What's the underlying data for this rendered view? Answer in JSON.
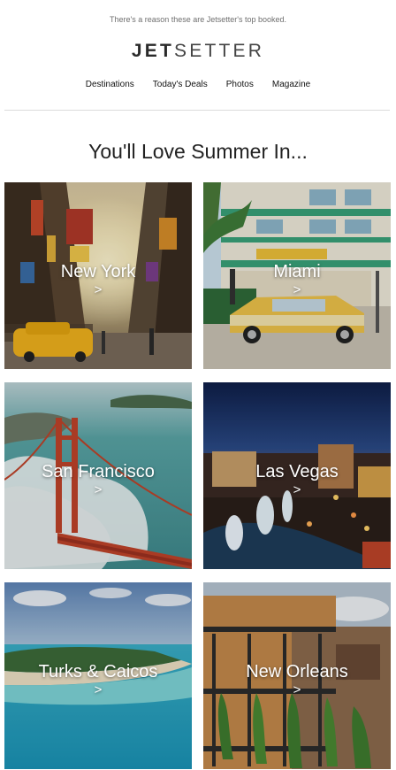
{
  "preheader": "There's a reason these are Jetsetter's top booked.",
  "logo": {
    "bold": "JET",
    "light": "SETTER"
  },
  "nav": [
    "Destinations",
    "Today's Deals",
    "Photos",
    "Magazine"
  ],
  "headline": "You'll Love Summer In...",
  "destinations": [
    {
      "name": "New York",
      "arrow": ">"
    },
    {
      "name": "Miami",
      "arrow": ">"
    },
    {
      "name": "San Francisco",
      "arrow": ">"
    },
    {
      "name": "Las Vegas",
      "arrow": ">"
    },
    {
      "name": "Turks & Caicos",
      "arrow": ">"
    },
    {
      "name": "New Orleans",
      "arrow": ">"
    }
  ]
}
